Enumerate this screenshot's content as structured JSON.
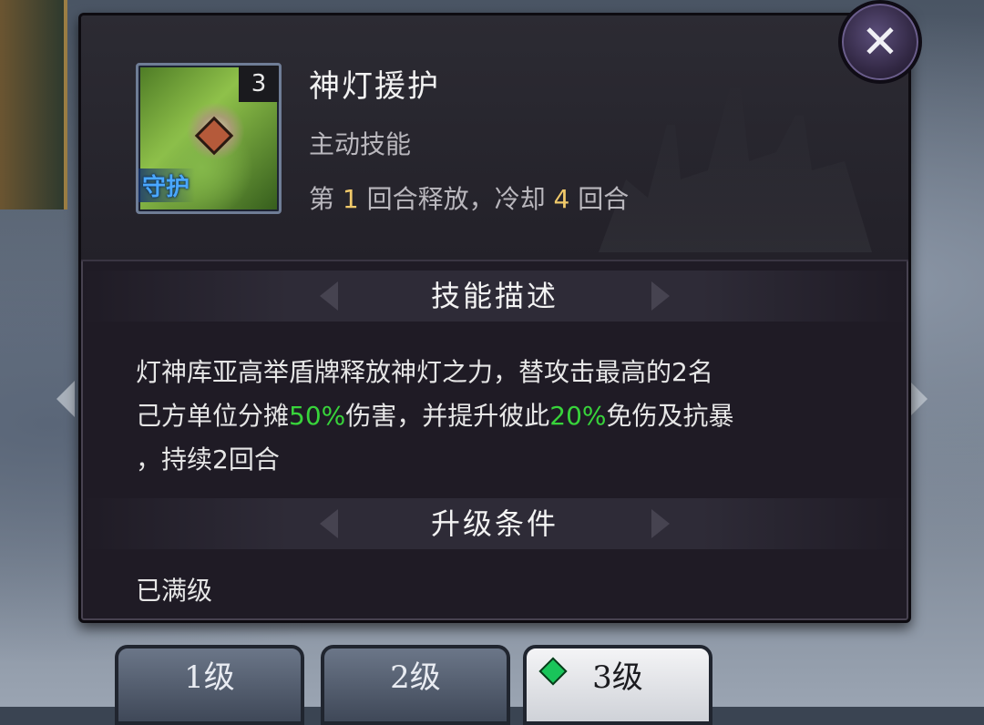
{
  "skill": {
    "icon_level": "3",
    "icon_tag": "守护",
    "name": "神灯援护",
    "type": "主动技能",
    "cooldown": {
      "prefix": "第 ",
      "release_round": "1",
      "mid": " 回合释放，冷却 ",
      "cooldown_rounds": "4",
      "suffix": " 回合"
    }
  },
  "sections": {
    "description_title": "技能描述",
    "upgrade_title": "升级条件"
  },
  "description": {
    "line1": "灯神库亚高举盾牌释放神灯之力，替攻击最高的2名",
    "line2_a": "己方单位分摊",
    "line2_pct1": "50%",
    "line2_b": "伤害，并提升彼此",
    "line2_pct2": "20%",
    "line2_c": "免伤及抗暴",
    "line3": "，持续2回合"
  },
  "upgrade": {
    "status": "已满级"
  },
  "tabs": [
    {
      "label": "1级"
    },
    {
      "label": "2级"
    },
    {
      "label": "3级"
    }
  ],
  "colors": {
    "highlight_green": "#38d43b",
    "number_gold": "#f0c96a",
    "panel_bg": "#1f1b25"
  },
  "icons": {
    "close": "close-icon",
    "tab_gem": "gem-icon"
  }
}
